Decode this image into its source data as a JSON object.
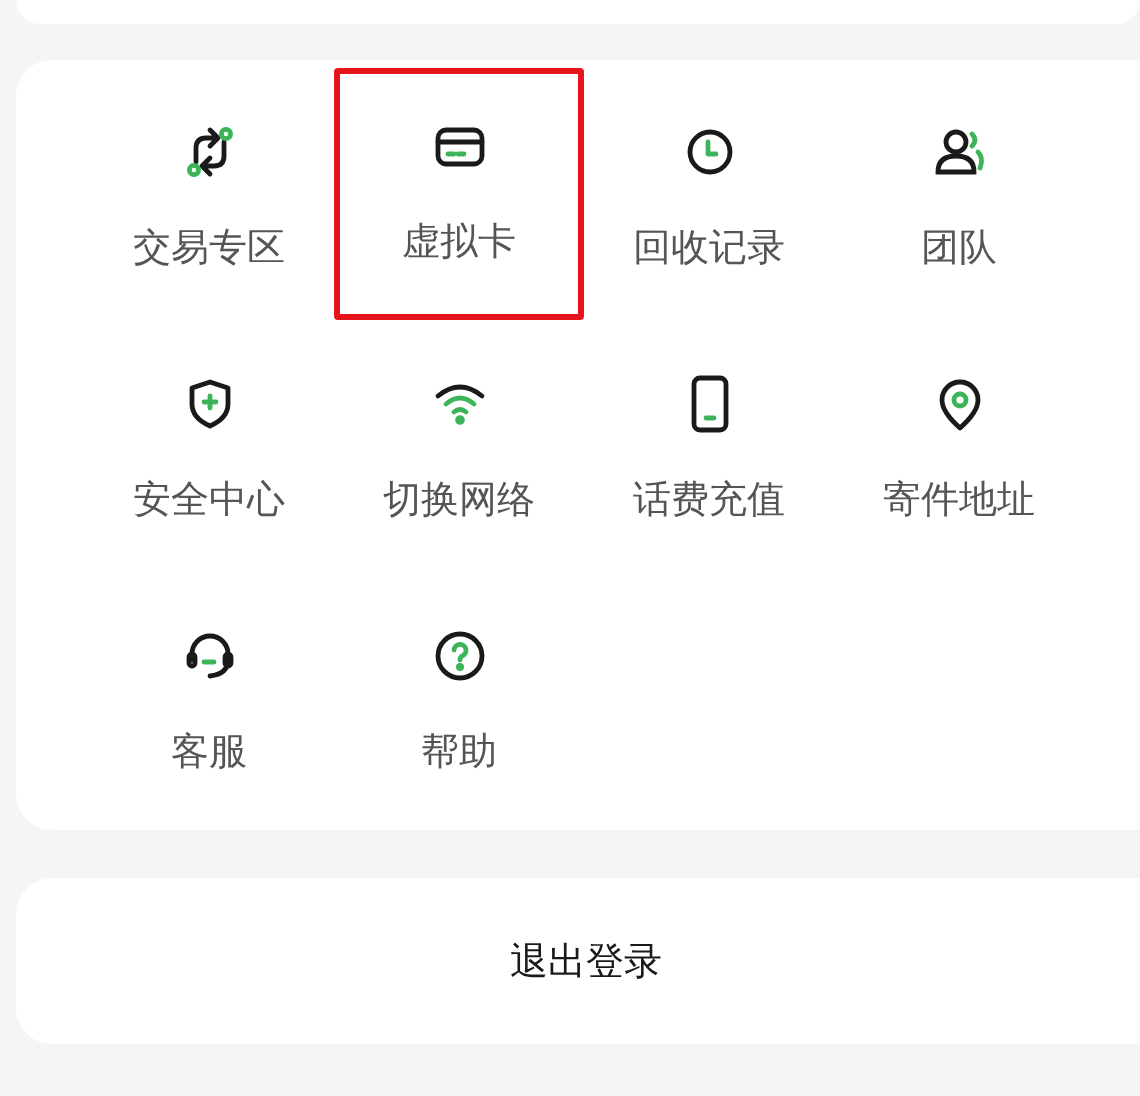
{
  "menu": {
    "items": [
      {
        "label": "交易专区",
        "kind": "exchange",
        "highlighted": false
      },
      {
        "label": "虚拟卡",
        "kind": "card",
        "highlighted": true
      },
      {
        "label": "回收记录",
        "kind": "clock",
        "highlighted": false
      },
      {
        "label": "团队",
        "kind": "people",
        "highlighted": false
      },
      {
        "label": "安全中心",
        "kind": "shield",
        "highlighted": false
      },
      {
        "label": "切换网络",
        "kind": "wifi",
        "highlighted": false
      },
      {
        "label": "话费充值",
        "kind": "phone",
        "highlighted": false
      },
      {
        "label": "寄件地址",
        "kind": "pin",
        "highlighted": false
      },
      {
        "label": "客服",
        "kind": "headset",
        "highlighted": false
      },
      {
        "label": "帮助",
        "kind": "help",
        "highlighted": false
      }
    ]
  },
  "logout_button": "退出登录"
}
